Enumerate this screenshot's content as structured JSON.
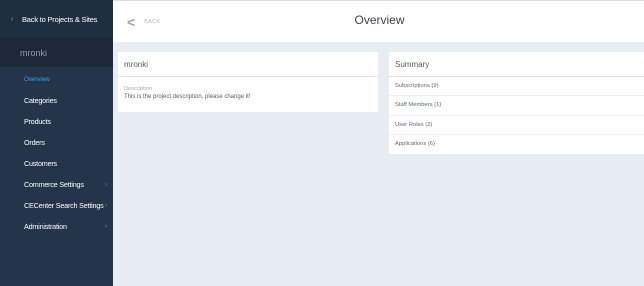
{
  "sidebar": {
    "back_label": "Back to Projects & Sites",
    "project_name": "mronki",
    "items": [
      {
        "label": "Overview",
        "active": true,
        "has_arrow": false
      },
      {
        "label": "Categories",
        "active": false,
        "has_arrow": false
      },
      {
        "label": "Products",
        "active": false,
        "has_arrow": false
      },
      {
        "label": "Orders",
        "active": false,
        "has_arrow": false
      },
      {
        "label": "Customers",
        "active": false,
        "has_arrow": false
      },
      {
        "label": "Commerce Settings",
        "active": false,
        "has_arrow": true
      },
      {
        "label": "CECenter Search Settings",
        "active": false,
        "has_arrow": true
      },
      {
        "label": "Administration",
        "active": false,
        "has_arrow": true
      }
    ]
  },
  "topbar": {
    "back_label": "BACK",
    "title": "Overview"
  },
  "project_card": {
    "title": "mronki",
    "description_label": "Description",
    "description_value": "This is the project description, please change it!"
  },
  "summary_card": {
    "title": "Summary",
    "rows": [
      {
        "label": "Subscriptions (9)"
      },
      {
        "label": "Staff Members (1)"
      },
      {
        "label": "User Roles (2)"
      },
      {
        "label": "Applications (6)"
      }
    ]
  },
  "colors": {
    "sidebar_bg": "#24354a",
    "active_item": "#3a9be5",
    "page_bg": "#e7edf3"
  }
}
